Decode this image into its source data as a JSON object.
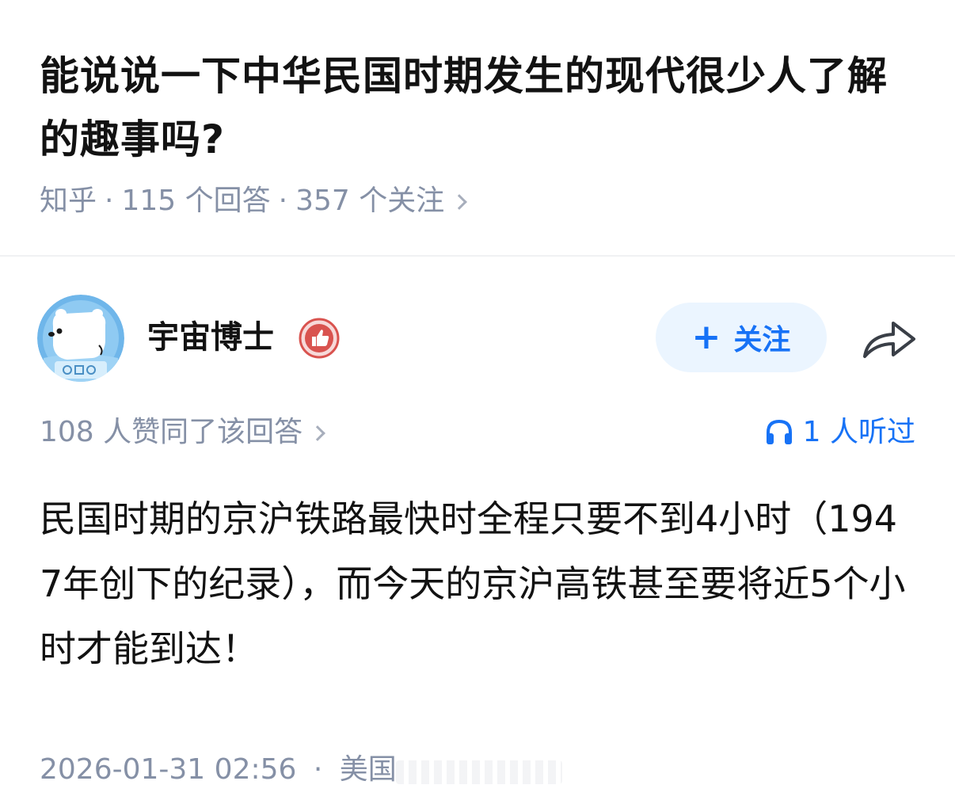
{
  "question": {
    "title": "能说说一下中华民国时期发生的现代很少人了解的趣事吗?",
    "source": "知乎",
    "answers": "115 个回答",
    "followers": "357 个关注",
    "separator": "·"
  },
  "author": {
    "name": "宇宙博士",
    "avatar_icon": "polar-bear-astronaut-avatar",
    "badge_icon": "thumbs-up-badge-icon"
  },
  "actions": {
    "follow_plus": "+",
    "follow_label": "关注",
    "share_icon": "share-arrow-icon"
  },
  "stats": {
    "votes": "108 人赞同了该回答",
    "listened": "1 人听过",
    "listened_icon": "headphones-icon"
  },
  "answer": {
    "content": "民国时期的京沪铁路最快时全程只要不到4小时（1947年创下的纪录），而今天的京沪高铁甚至要将近5个小时才能到达！"
  },
  "footer": {
    "datetime": "2026-01-31 02:56",
    "separator": "·",
    "location": "美国"
  },
  "colors": {
    "accent": "#1772f6",
    "follow_bg": "#ebf5ff",
    "meta_text": "#8590a6",
    "title_text": "#121212"
  }
}
